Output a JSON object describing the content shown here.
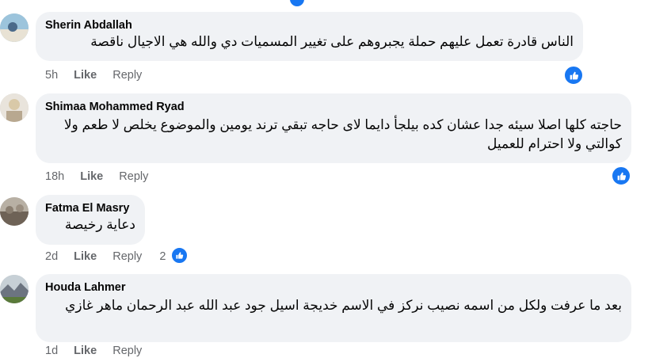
{
  "comments": [
    {
      "author": "Sherin Abdallah",
      "text": "الناس قادرة تعمل عليهم حملة يجبروهم على تغيير المسميات دي والله هي الاجيال ناقصة",
      "time": "5h",
      "like_label": "Like",
      "reply_label": "Reply",
      "reaction_icon": "like-icon"
    },
    {
      "author": "Shimaa Mohammed Ryad",
      "text": "حاجته كلها اصلا سيئه جدا عشان كده بيلجأ دايما لاى حاجه تبقي ترند يومين والموضوع يخلص لا طعم ولا كوالتي ولا احترام للعميل",
      "time": "18h",
      "like_label": "Like",
      "reply_label": "Reply",
      "reaction_icon": "like-icon"
    },
    {
      "author": "Fatma El Masry",
      "text": "دعاية رخيصة",
      "time": "2d",
      "like_label": "Like",
      "reply_label": "Reply",
      "reaction_count": "2",
      "reaction_icon": "like-icon"
    },
    {
      "author": "Houda Lahmer",
      "text": "بعد ما عرفت ولكل من اسمه نصيب نركز في الاسم خديجة اسيل جود عبد الله عبد الرحمان ماهر غازي",
      "time": "1d",
      "like_label": "Like",
      "reply_label": "Reply"
    }
  ],
  "colors": {
    "bubble": "#f0f2f5",
    "meta_text": "#65676b",
    "like_blue": "#1877f2"
  }
}
